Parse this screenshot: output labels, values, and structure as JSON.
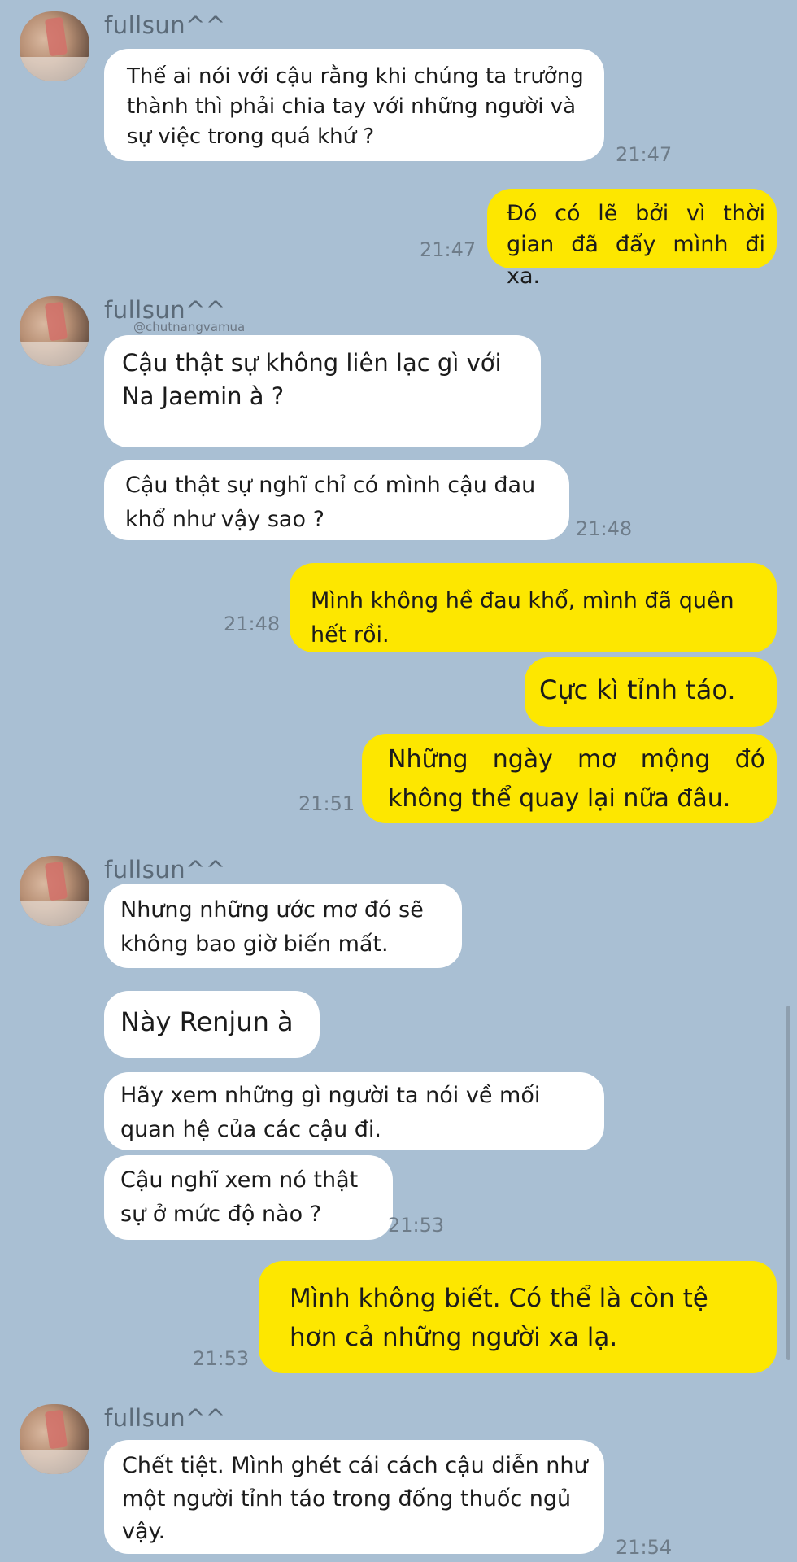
{
  "contact_name": "fullsun^^",
  "watermark": "@chutnangvamua",
  "messages": [
    {
      "text": "Thế ai nói với cậu rằng khi chúng ta trưởng thành thì phải chia tay với những người và sự việc trong quá khứ ?",
      "time": "21:47"
    },
    {
      "text": "Đó có lẽ bởi vì thời gian đã đẩy mình đi xa.",
      "time": "21:47"
    },
    {
      "text": "Cậu thật sự không liên lạc gì với Na Jaemin à ?"
    },
    {
      "text": "Cậu thật sự nghĩ chỉ có mình cậu đau khổ như vậy sao ?",
      "time": "21:48"
    },
    {
      "text": "Mình không hề đau khổ, mình đã quên hết rồi.",
      "time": "21:48"
    },
    {
      "text": "Cực kì tỉnh táo."
    },
    {
      "text": "Những ngày mơ mộng đó không thể quay lại nữa đâu.",
      "time": "21:51"
    },
    {
      "text": "Nhưng những ước mơ đó sẽ không bao giờ biến mất."
    },
    {
      "text": "Này Renjun à"
    },
    {
      "text": "Hãy xem những gì người ta nói về mối quan hệ của các cậu đi."
    },
    {
      "text": "Cậu nghĩ xem nó thật sự ở mức độ nào ?",
      "time": "21:53"
    },
    {
      "text": "Mình không biết. Có thể là còn tệ hơn cả những người xa lạ.",
      "time": "21:53"
    },
    {
      "text": "Chết tiệt. Mình ghét cái cách cậu diễn như một người tỉnh táo trong đống thuốc ngủ vậy.",
      "time": "21:54"
    }
  ]
}
